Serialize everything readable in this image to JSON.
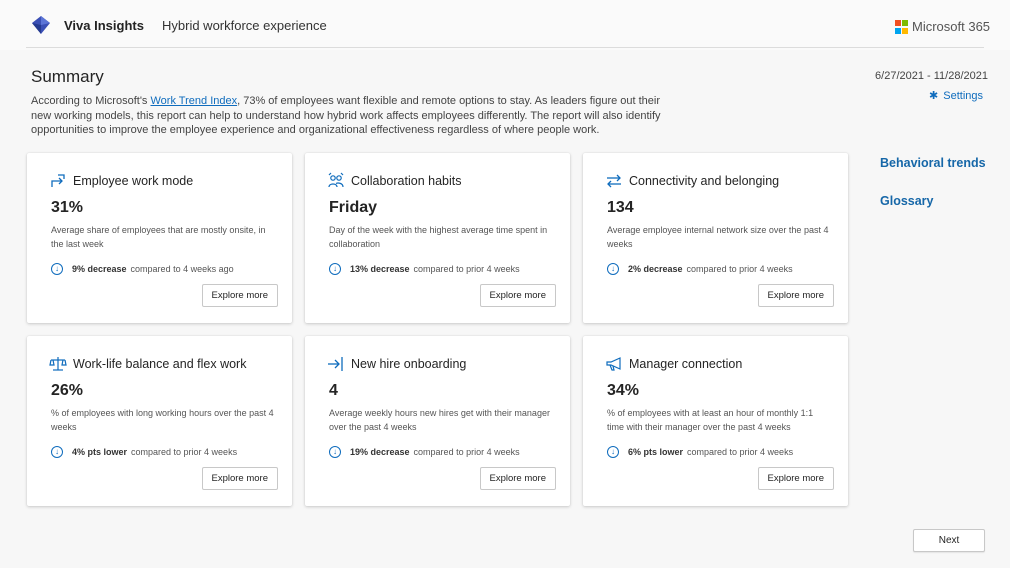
{
  "header": {
    "app_name": "Viva Insights",
    "report_name": "Hybrid workforce experience",
    "brand": "Microsoft 365",
    "ms_colors": [
      "#f25022",
      "#7fba00",
      "#00a4ef",
      "#ffb900"
    ]
  },
  "summary": {
    "title": "Summary",
    "text_before_link": "According to Microsoft's ",
    "link_text": "Work Trend Index",
    "text_after_link": ", 73% of employees want flexible and remote options to stay. As leaders figure out their new working models, this report can help to understand how hybrid work affects employees differently. The report will also identify opportunities to improve the employee experience and organizational effectiveness regardless of where people work.",
    "date_range": "6/27/2021 - 11/28/2021",
    "settings_label": "Settings"
  },
  "side_links": {
    "behavioral_trends": "Behavioral trends",
    "glossary": "Glossary"
  },
  "accent_color": "#0f6cbd",
  "cards": [
    {
      "icon": "work-mode-icon",
      "title": "Employee work mode",
      "metric": "31%",
      "description": "Average share of employees that are mostly onsite, in the last week",
      "change_strong": "9% decrease",
      "change_rest": "compared to 4 weeks ago",
      "button": "Explore more"
    },
    {
      "icon": "collaboration-icon",
      "title": "Collaboration habits",
      "metric": "Friday",
      "description": "Day of the week with the highest average time spent in collaboration",
      "change_strong": "13% decrease",
      "change_rest": "compared to prior 4 weeks",
      "button": "Explore more"
    },
    {
      "icon": "connectivity-icon",
      "title": "Connectivity and belonging",
      "metric": "134",
      "description": "Average employee internal network size over the past 4 weeks",
      "change_strong": "2% decrease",
      "change_rest": "compared to prior 4 weeks",
      "button": "Explore more"
    },
    {
      "icon": "balance-scale-icon",
      "title": "Work-life balance and flex work",
      "metric": "26%",
      "description": "% of employees with long working hours over the past 4 weeks",
      "change_strong": "4% pts lower",
      "change_rest": "compared to prior 4 weeks",
      "button": "Explore more"
    },
    {
      "icon": "onboarding-icon",
      "title": "New hire onboarding",
      "metric": "4",
      "description": "Average weekly hours new hires get with their manager over the past 4 weeks",
      "change_strong": "19% decrease",
      "change_rest": "compared to prior 4 weeks",
      "button": "Explore more"
    },
    {
      "icon": "megaphone-icon",
      "title": "Manager connection",
      "metric": "34%",
      "description": "% of employees with at least an hour of monthly 1:1 time with their manager over the past 4 weeks",
      "change_strong": "6% pts lower",
      "change_rest": "compared to prior 4 weeks",
      "button": "Explore more"
    }
  ],
  "footer": {
    "next_label": "Next"
  }
}
